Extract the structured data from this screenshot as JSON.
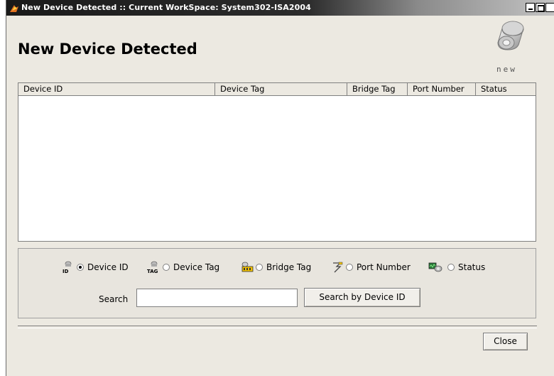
{
  "window": {
    "title": "New Device Detected :: Current WorkSpace: System302-ISA2004",
    "min_label": "",
    "max_label": "",
    "close_label": "x"
  },
  "heading": "New Device Detected",
  "brand_caption": "new",
  "table": {
    "columns": [
      "Device ID",
      "Device Tag",
      "Bridge Tag",
      "Port Number",
      "Status"
    ],
    "rows": []
  },
  "filters": {
    "selected": "Device ID",
    "options": [
      {
        "label": "Device ID",
        "icon": "device-id-icon",
        "icon_text": "ID"
      },
      {
        "label": "Device Tag",
        "icon": "device-tag-icon",
        "icon_text": "TAG"
      },
      {
        "label": "Bridge Tag",
        "icon": "bridge-tag-icon"
      },
      {
        "label": "Port Number",
        "icon": "port-number-icon"
      },
      {
        "label": "Status",
        "icon": "status-icon"
      }
    ]
  },
  "search": {
    "label": "Search",
    "value": "",
    "placeholder": "",
    "button_label": "Search by Device ID"
  },
  "footer": {
    "close_label": "Close"
  },
  "colors": {
    "titlebar": "#1a1a1a",
    "window_bg": "#ece9e1",
    "accent_yellow": "#f0c000"
  }
}
